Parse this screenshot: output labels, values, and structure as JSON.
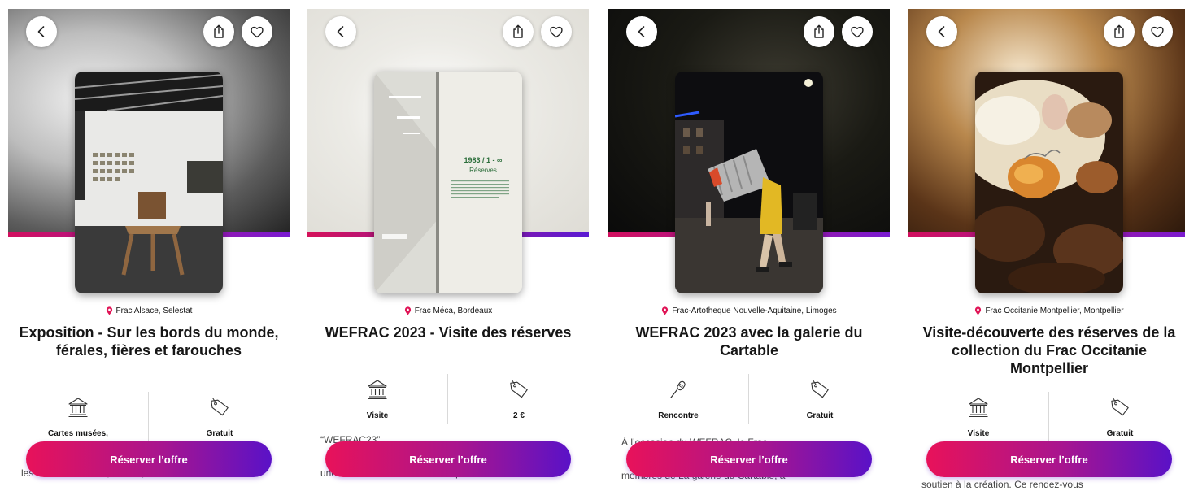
{
  "colors": {
    "accent_start": "#e8125a",
    "accent_end": "#5a12c7",
    "pin": "#e01456",
    "text": "#151515"
  },
  "icons": {
    "back": "chevron-left-icon",
    "share": "share-icon",
    "favorite": "heart-icon",
    "location": "location-pin-icon",
    "museum": "museum-icon",
    "price": "price-tag-icon",
    "meeting": "microphone-icon"
  },
  "screens": [
    {
      "venue": "Frac Alsace, Selestat",
      "title": "Exposition - Sur les bords du monde, férales, fières et farouches",
      "info_left": "Cartes musées,",
      "info_right": "Gratuit",
      "desc_lines": [
        "",
        "les bords du monde, férales, fières et"
      ],
      "cta": "Réserver l’offre"
    },
    {
      "venue": "Frac Méca, Bordeaux",
      "title": "WEFRAC 2023 - Visite des réserves",
      "info_left": "Visite",
      "info_right": "2 €",
      "poster_line1": "1983 / 1 - ∞",
      "poster_line2": "Réserves",
      "desc_lines": [
        "“WEFRAC23”",
        "une médiatrice. Le Frac n’aura plus aucun"
      ],
      "cta": "Réserver l’offre"
    },
    {
      "venue": "Frac-Artotheque Nouvelle-Aquitaine, Limoges",
      "title": "WEFRAC 2023 avec la galerie du Cartable",
      "info_left": "Rencontre",
      "info_right": "Gratuit",
      "desc_lines": [
        "À l’occasion du WEFRAC, le Frac",
        "membres de La galerie du Cartable, à"
      ],
      "cta": "Réserver l’offre"
    },
    {
      "venue": "Frac Occitanie Montpellier, Montpellier",
      "title": "Visite-découverte des réserves de la collection du Frac Occitanie Montpellier",
      "info_left": "Visite",
      "info_right": "Gratuit",
      "desc_lines": [
        "soutien à la création. Ce rendez-vous"
      ],
      "cta": "Réserver l’offre"
    }
  ]
}
